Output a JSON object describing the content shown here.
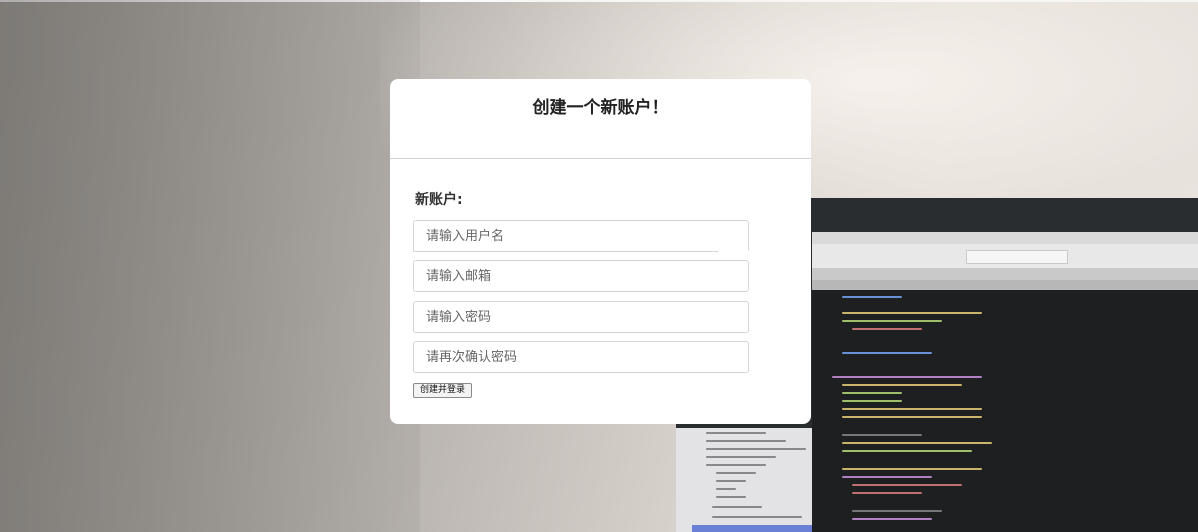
{
  "card": {
    "title": "创建一个新账户！",
    "section_label": "新账户:",
    "fields": {
      "username_placeholder": "请输入用户名",
      "email_placeholder": "请输入邮箱",
      "password_placeholder": "请输入密码",
      "confirm_password_placeholder": "请再次确认密码"
    },
    "submit_label": "创建并登录"
  },
  "colors": {
    "card_background": "#ffffff",
    "title_text": "#222222",
    "divider": "#d2d2d2"
  }
}
